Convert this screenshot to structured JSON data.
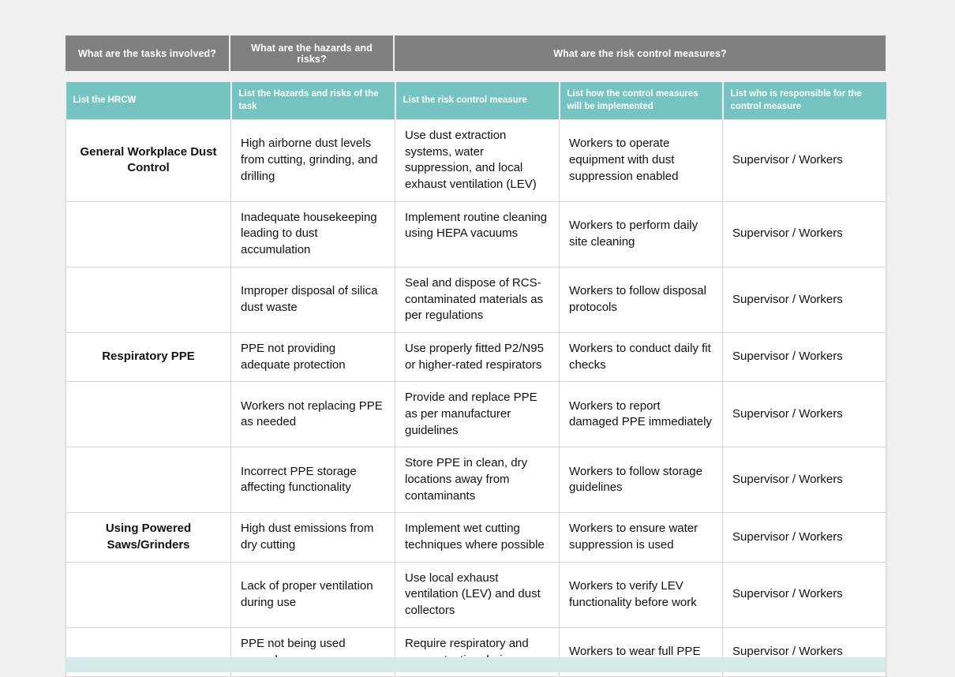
{
  "colors": {
    "page_background": "#f0f0f0",
    "group_header_background": "#808080",
    "column_header_background": "#75c4c2",
    "cell_background": "#ffffff",
    "cell_border": "#d6d6d6",
    "bottom_bar": "#d4eaea",
    "header_text": "#ffffff",
    "body_text": "#111111"
  },
  "group_headers": [
    {
      "label": "What are the tasks involved?"
    },
    {
      "label": "What are the hazards and risks?"
    },
    {
      "label": "What are the risk control measures?"
    }
  ],
  "column_headers": [
    {
      "label": "List the HRCW"
    },
    {
      "label": "List the Hazards and risks of the task"
    },
    {
      "label": "List the risk control measure"
    },
    {
      "label": "List how the control measures will be implemented"
    },
    {
      "label": "List who is responsible for the control measure"
    }
  ],
  "rows": [
    {
      "task": "General Workplace Dust Control",
      "hazard": "High airborne dust levels from cutting, grinding, and drilling",
      "control": "Use dust extraction systems, water suppression, and local exhaust ventilation (LEV)",
      "implementation": "Workers to operate equipment with dust suppression enabled",
      "responsible": "Supervisor / Workers"
    },
    {
      "task": "",
      "hazard": "Inadequate housekeeping leading to dust accumulation",
      "control": "Implement routine cleaning using HEPA vacuums",
      "implementation": "Workers to perform daily site cleaning",
      "responsible": "Supervisor / Workers"
    },
    {
      "task": "",
      "hazard": "Improper disposal of silica dust waste",
      "control": "Seal and dispose of RCS-contaminated materials as per regulations",
      "implementation": "Workers to follow disposal protocols",
      "responsible": "Supervisor / Workers"
    },
    {
      "task": "Respiratory PPE",
      "hazard": "PPE not providing adequate protection",
      "control": "Use properly fitted P2/N95 or higher-rated respirators",
      "implementation": "Workers to conduct daily fit checks",
      "responsible": "Supervisor / Workers"
    },
    {
      "task": "",
      "hazard": "Workers not replacing PPE as needed",
      "control": "Provide and replace PPE as per manufacturer guidelines",
      "implementation": "Workers to report damaged PPE immediately",
      "responsible": "Supervisor / Workers"
    },
    {
      "task": "",
      "hazard": "Incorrect PPE storage affecting functionality",
      "control": "Store PPE in clean, dry locations away from contaminants",
      "implementation": "Workers to follow storage guidelines",
      "responsible": "Supervisor / Workers"
    },
    {
      "task": "Using Powered Saws/Grinders",
      "hazard": "High dust emissions from dry cutting",
      "control": "Implement wet cutting techniques where possible",
      "implementation": "Workers to ensure water suppression is used",
      "responsible": "Supervisor / Workers"
    },
    {
      "task": "",
      "hazard": "Lack of proper ventilation during use",
      "control": "Use local exhaust ventilation (LEV) and dust collectors",
      "implementation": "Workers to verify LEV functionality before work",
      "responsible": "Supervisor / Workers"
    },
    {
      "task": "",
      "hazard": "PPE not being used properly",
      "control": "Require respiratory and eye protection during use",
      "implementation": "Workers to wear full PPE",
      "responsible": "Supervisor / Workers"
    }
  ]
}
